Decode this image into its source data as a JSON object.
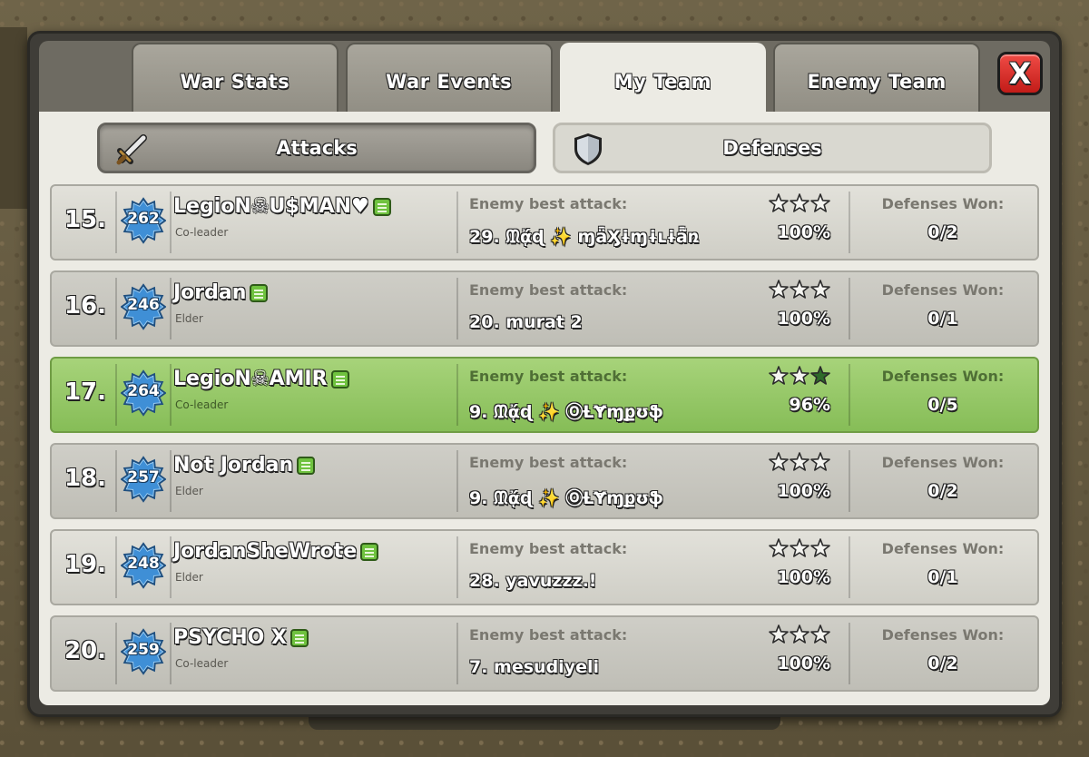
{
  "tabs": [
    {
      "label": "War Stats",
      "active": false
    },
    {
      "label": "War Events",
      "active": false
    },
    {
      "label": "My Team",
      "active": true
    },
    {
      "label": "Enemy Team",
      "active": false
    }
  ],
  "close_label": "X",
  "subtabs": {
    "attacks": "Attacks",
    "defenses": "Defenses",
    "selected": "defenses"
  },
  "labels": {
    "enemy_best_attack": "Enemy best attack:",
    "defenses_won": "Defenses Won:"
  },
  "colors": {
    "highlight_row": "#86bd57",
    "badge_blue": "#3f8fd6",
    "close_red": "#d62a24",
    "star_filled": "#2f6b2a"
  },
  "players": [
    {
      "rank": "15.",
      "th_level": "262",
      "name": "LegioN☠U$MAN♥",
      "role": "Co-leader",
      "attack": "29. ᙢᾄɖ ✨ ɱǟӼɨɱɨʟɨǟ̃ռ",
      "stars_earned": 0,
      "percent": "100%",
      "defenses_won": "0/2",
      "highlight": false
    },
    {
      "rank": "16.",
      "th_level": "246",
      "name": "Jordan",
      "role": "Elder",
      "attack": "20. murat 2",
      "stars_earned": 0,
      "percent": "100%",
      "defenses_won": "0/1",
      "highlight": false
    },
    {
      "rank": "17.",
      "th_level": "264",
      "name": "LegioN☠AMIR",
      "role": "Co-leader",
      "attack": "9. ᙢᾄɖ ✨ ⓄȽɎɱքʊֆ",
      "stars_earned": 1,
      "percent": "96%",
      "defenses_won": "0/5",
      "highlight": true
    },
    {
      "rank": "18.",
      "th_level": "257",
      "name": "Not Jordan",
      "role": "Elder",
      "attack": "9. ᙢᾄɖ ✨ ⓄȽɎɱքʊֆ",
      "stars_earned": 0,
      "percent": "100%",
      "defenses_won": "0/2",
      "highlight": false
    },
    {
      "rank": "19.",
      "th_level": "248",
      "name": "JordanSheWrote",
      "role": "Elder",
      "attack": "28. yavuzzz.!",
      "stars_earned": 0,
      "percent": "100%",
      "defenses_won": "0/1",
      "highlight": false
    },
    {
      "rank": "20.",
      "th_level": "259",
      "name": "PSYCHO X",
      "role": "Co-leader",
      "attack": "7. mesudiyeli",
      "stars_earned": 0,
      "percent": "100%",
      "defenses_won": "0/2",
      "highlight": false
    }
  ]
}
